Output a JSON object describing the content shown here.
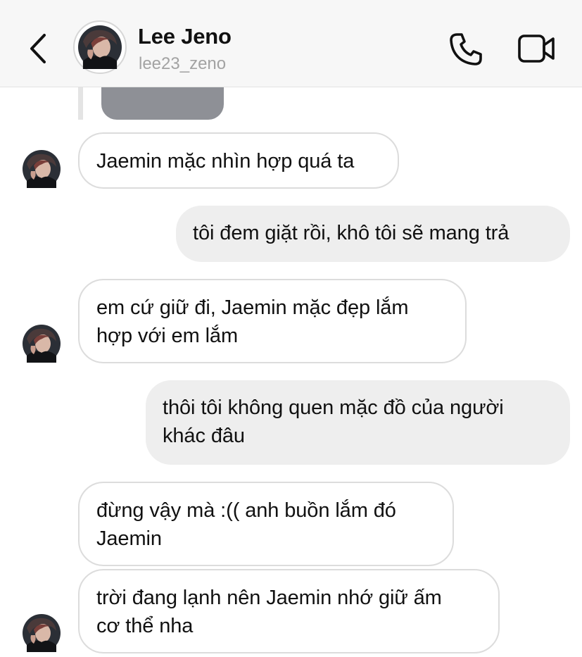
{
  "header": {
    "name": "Lee Jeno",
    "username": "lee23_zeno",
    "icons": {
      "back": "chevron-left-icon",
      "call": "phone-icon",
      "video": "video-camera-icon"
    }
  },
  "messages": [
    {
      "direction": "incoming",
      "text": "Jaemin mặc nhìn hợp quá ta"
    },
    {
      "direction": "outgoing",
      "text": "tôi đem giặt rồi, khô tôi sẽ mang trả"
    },
    {
      "direction": "incoming",
      "lines": [
        "em cứ giữ đi, Jaemin mặc đẹp lắm",
        "hợp với em lắm"
      ]
    },
    {
      "direction": "outgoing",
      "lines": [
        "thôi tôi không quen mặc đồ của người",
        "khác đâu"
      ]
    },
    {
      "direction": "incoming",
      "lines": [
        "đừng vậy mà :(( anh buồn lắm đó",
        "Jaemin"
      ]
    },
    {
      "direction": "incoming",
      "lines": [
        "trời đang lạnh nên Jaemin nhớ giữ ấm",
        "cơ thể nha"
      ]
    }
  ],
  "colors": {
    "header_bg": "#f7f7f7",
    "incoming_bubble_bg": "#ffffff",
    "incoming_bubble_border": "#dcdcdc",
    "outgoing_bubble_bg": "#eeeeee",
    "username": "#a3a3a3",
    "media_preview": "#8e9096"
  }
}
